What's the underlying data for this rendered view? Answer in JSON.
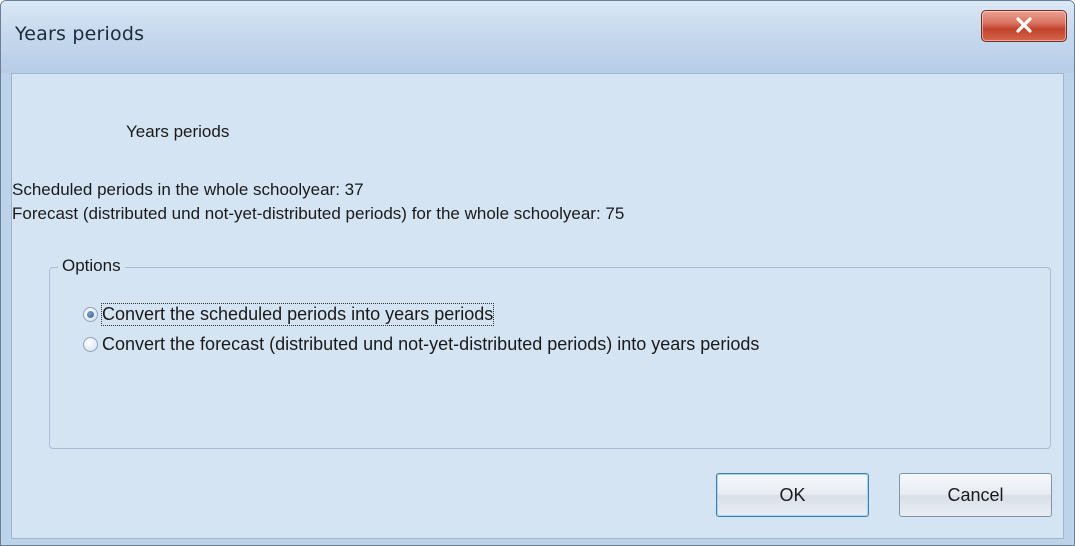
{
  "window": {
    "title": "Years periods"
  },
  "content": {
    "heading": "Years periods",
    "scheduled_line": "Scheduled periods in the whole schoolyear: 37",
    "forecast_line": "Forecast (distributed und not-yet-distributed periods) for the whole schoolyear: 75"
  },
  "options": {
    "legend": "Options",
    "items": [
      {
        "label": "Convert the scheduled periods into years periods",
        "selected": true
      },
      {
        "label": "Convert the forecast (distributed und not-yet-distributed periods) into years periods",
        "selected": false
      }
    ]
  },
  "buttons": {
    "ok_label": "OK",
    "cancel_label": "Cancel"
  },
  "icons": {
    "close": "close-icon"
  },
  "colors": {
    "client_bg": "#d4e4f3",
    "close_button": "#c2432c"
  }
}
